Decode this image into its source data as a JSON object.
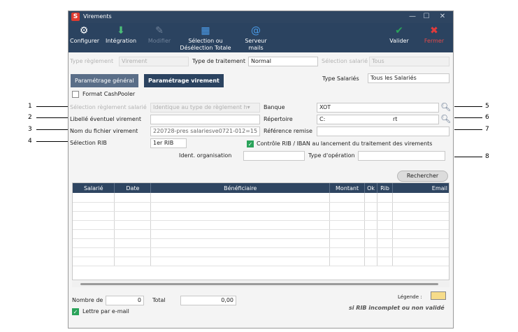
{
  "window": {
    "title": "Virements",
    "logo": "S",
    "controls": [
      "—",
      "☐",
      "✕"
    ]
  },
  "toolbar": {
    "configurer": "Configurer",
    "integration": "Intégration",
    "modifier": "Modifier",
    "selection": "Sélection ou Désélection Totale",
    "serveur": "Serveur mails",
    "valider": "Valider",
    "fermer": "Fermer"
  },
  "filters": {
    "type_reglement_label": "Type règlement",
    "type_reglement_value": "Virement",
    "type_traitement_label": "Type de traitement",
    "type_traitement_value": "Normal",
    "selection_salarie_label": "Sélection salarié",
    "selection_salarie_value": "Tous"
  },
  "tabs": {
    "general": "Paramétrage général",
    "virement": "Paramétrage virement"
  },
  "type_salaries": {
    "label": "Type Salariés",
    "value": "Tous les Salariés"
  },
  "format_cashpooler": "Format CashPooler",
  "form": {
    "selection_reglement_label": "Sélection règlement salarié",
    "selection_reglement_value": "Identique au type de règlement h▾",
    "libelle_label": "Libellé éventuel virement",
    "nom_fichier_label": "Nom du fichier virement",
    "nom_fichier_value": "220728-pres salariesve0721-012=15",
    "selection_rib_label": "Sélection RIB",
    "selection_rib_value": "1er RIB",
    "banque_label": "Banque",
    "banque_value": "XOT",
    "repertoire_label": "Répertoire",
    "repertoire_value": "C:",
    "repertoire_suffix": "rt",
    "reference_label": "Référence remise",
    "controle_label": "Contrôle RIB / IBAN au lancement du traitement des virements",
    "ident_label": "Ident. organisation",
    "type_operation_label": "Type d'opération"
  },
  "rechercher": "Rechercher",
  "table": {
    "columns": [
      "Salarié",
      "Date",
      "Bénéficiaire",
      "Montant",
      "Ok",
      "Rib",
      "Email"
    ]
  },
  "footer": {
    "nombre_label": "Nombre de",
    "nombre_value": "0",
    "total_label": "Total",
    "total_value": "0,00",
    "lettre": "Lettre par e-mail",
    "legende": "Légende :",
    "rib_note": "si RIB incomplet ou non validé"
  },
  "annotations": [
    "1",
    "2",
    "3",
    "4",
    "5",
    "6",
    "7",
    "8"
  ],
  "colors": {
    "header": "#2e4561",
    "active_tab": "#2b4360",
    "inactive_tab": "#5a6e88",
    "valider": "#2aa35a",
    "fermer": "#e23b3b"
  }
}
